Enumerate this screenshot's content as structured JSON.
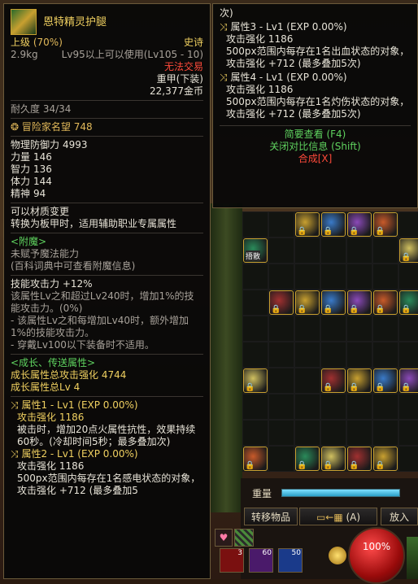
{
  "item_tooltip": {
    "name": "恩特精灵护腿",
    "grade": "上级",
    "grade_pct": "(70%)",
    "rarity": "史诗",
    "weight": "2.9kg",
    "level_req": "Lv95以上可以使用(Lv105 - 10)",
    "trade": "无法交易",
    "armor_type": "重甲(下装)",
    "price": "22,377金币",
    "durability": "耐久度 34/34",
    "adventurer_fame": "冒险家名望 748",
    "stats": [
      {
        "label": "物理防御力",
        "value": "4993"
      },
      {
        "label": "力量",
        "value": "146"
      },
      {
        "label": "智力",
        "value": "136"
      },
      {
        "label": "体力",
        "value": "144"
      },
      {
        "label": "精神",
        "value": "94"
      }
    ],
    "material_change": "可以材质变更",
    "material_desc": "转换为板甲时，适用辅助职业专属属性",
    "enchant_header": "<附魔>",
    "enchant_none": "未赋予魔法能力",
    "enchant_hint": "(百科词典中可查看附魔信息)",
    "skill_atk": "技能攻击力 +12%",
    "skill_desc1": "该属性Lv之和超过Lv240时，增加1%的技能攻击力。(0%)",
    "skill_desc2": "- 该属性Lv之和每增加Lv40时，额外增加1%的技能攻击力。",
    "skill_desc3": "- 穿戴Lv100以下装备时不适用。",
    "growth_header": "<成长、传送属性>",
    "growth_total_atk": "成长属性总攻击强化 4744",
    "growth_total_lv": "成长属性总Lv 4",
    "attr1_title": "属性1 - Lv1 (EXP 0.00%)",
    "attr1_atk": "攻击强化 1186",
    "attr1_desc": "被击时，增加20点火属性抗性，效果持续60秒。(冷却时间5秒；最多叠加次)",
    "attr2_title": "属性2 - Lv1 (EXP 0.00%)",
    "attr2_atk": "攻击强化 1186",
    "attr2_desc": "500px范围内每存在1名感电状态的对象，攻击强化 +712 (最多叠加5"
  },
  "side_tooltip": {
    "top_text": "次)",
    "attr3_title": "属性3 - Lv1 (EXP 0.00%)",
    "attr3_atk": "攻击强化 1186",
    "attr3_desc": "500px范围内每存在1名出血状态的对象，攻击强化 +712 (最多叠加5次)",
    "attr4_title": "属性4 - Lv1 (EXP 0.00%)",
    "attr4_atk": "攻击强化 1186",
    "attr4_desc": "500px范围内每存在1名灼伤状态的对象，攻击强化 +712 (最多叠加5次)",
    "brief": "简要查看 (F4)",
    "close_compare": "关闭对比信息 (Shift)",
    "synth": "合成[X]"
  },
  "inventory": {
    "weight_label": "重量",
    "transfer_button": "转移物品",
    "sort_label": "(A)",
    "put_button": "放入",
    "rental_tag": "捂散",
    "hp_orb": "100%",
    "quick_counts": [
      "3",
      "60",
      "50"
    ]
  },
  "colors": {
    "gold": "#e2b95a",
    "epic": "#f0d060",
    "green": "#5fd35f",
    "red": "#ff4a3a"
  }
}
